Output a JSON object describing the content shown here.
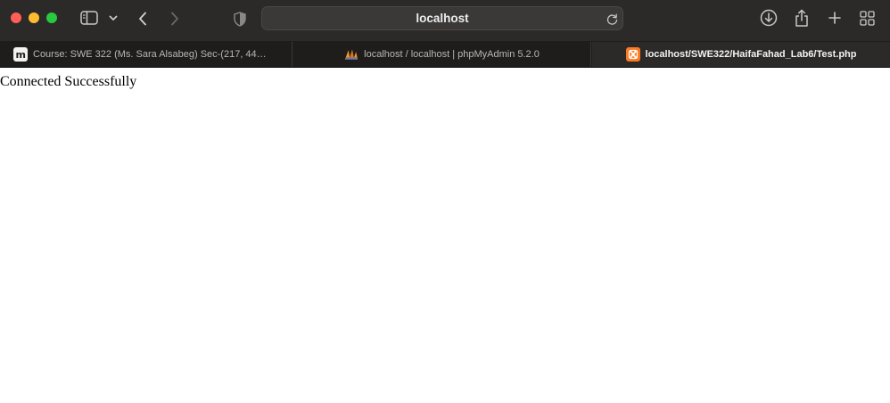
{
  "window": {
    "traffic_lights": [
      "close",
      "minimize",
      "zoom"
    ],
    "traffic_colors": [
      "#ff5f57",
      "#febc2e",
      "#28c840"
    ]
  },
  "toolbar": {
    "address": "localhost",
    "icons": [
      "sidebar-icon",
      "chevron-down-icon",
      "back-icon",
      "forward-icon",
      "shield-icon",
      "reload-icon",
      "download-icon",
      "share-icon",
      "plus-icon",
      "tab-overview-icon"
    ]
  },
  "tabs": [
    {
      "label": "Course: SWE 322 (Ms. Sara Alsabeg) Sec-(217, 44…",
      "icon": "moodle-icon",
      "active": false
    },
    {
      "label": "localhost / localhost | phpMyAdmin 5.2.0",
      "icon": "phpmyadmin-icon",
      "active": false
    },
    {
      "label": "localhost/SWE322/HaifaFahad_Lab6/Test.php",
      "icon": "xampp-icon",
      "active": true
    }
  ],
  "page": {
    "text": "Connected Successfully"
  },
  "colors": {
    "toolbar_bg": "#2c2a28",
    "tabbar_bg": "#1e1d1c",
    "xampp_orange": "#fb7a24"
  }
}
